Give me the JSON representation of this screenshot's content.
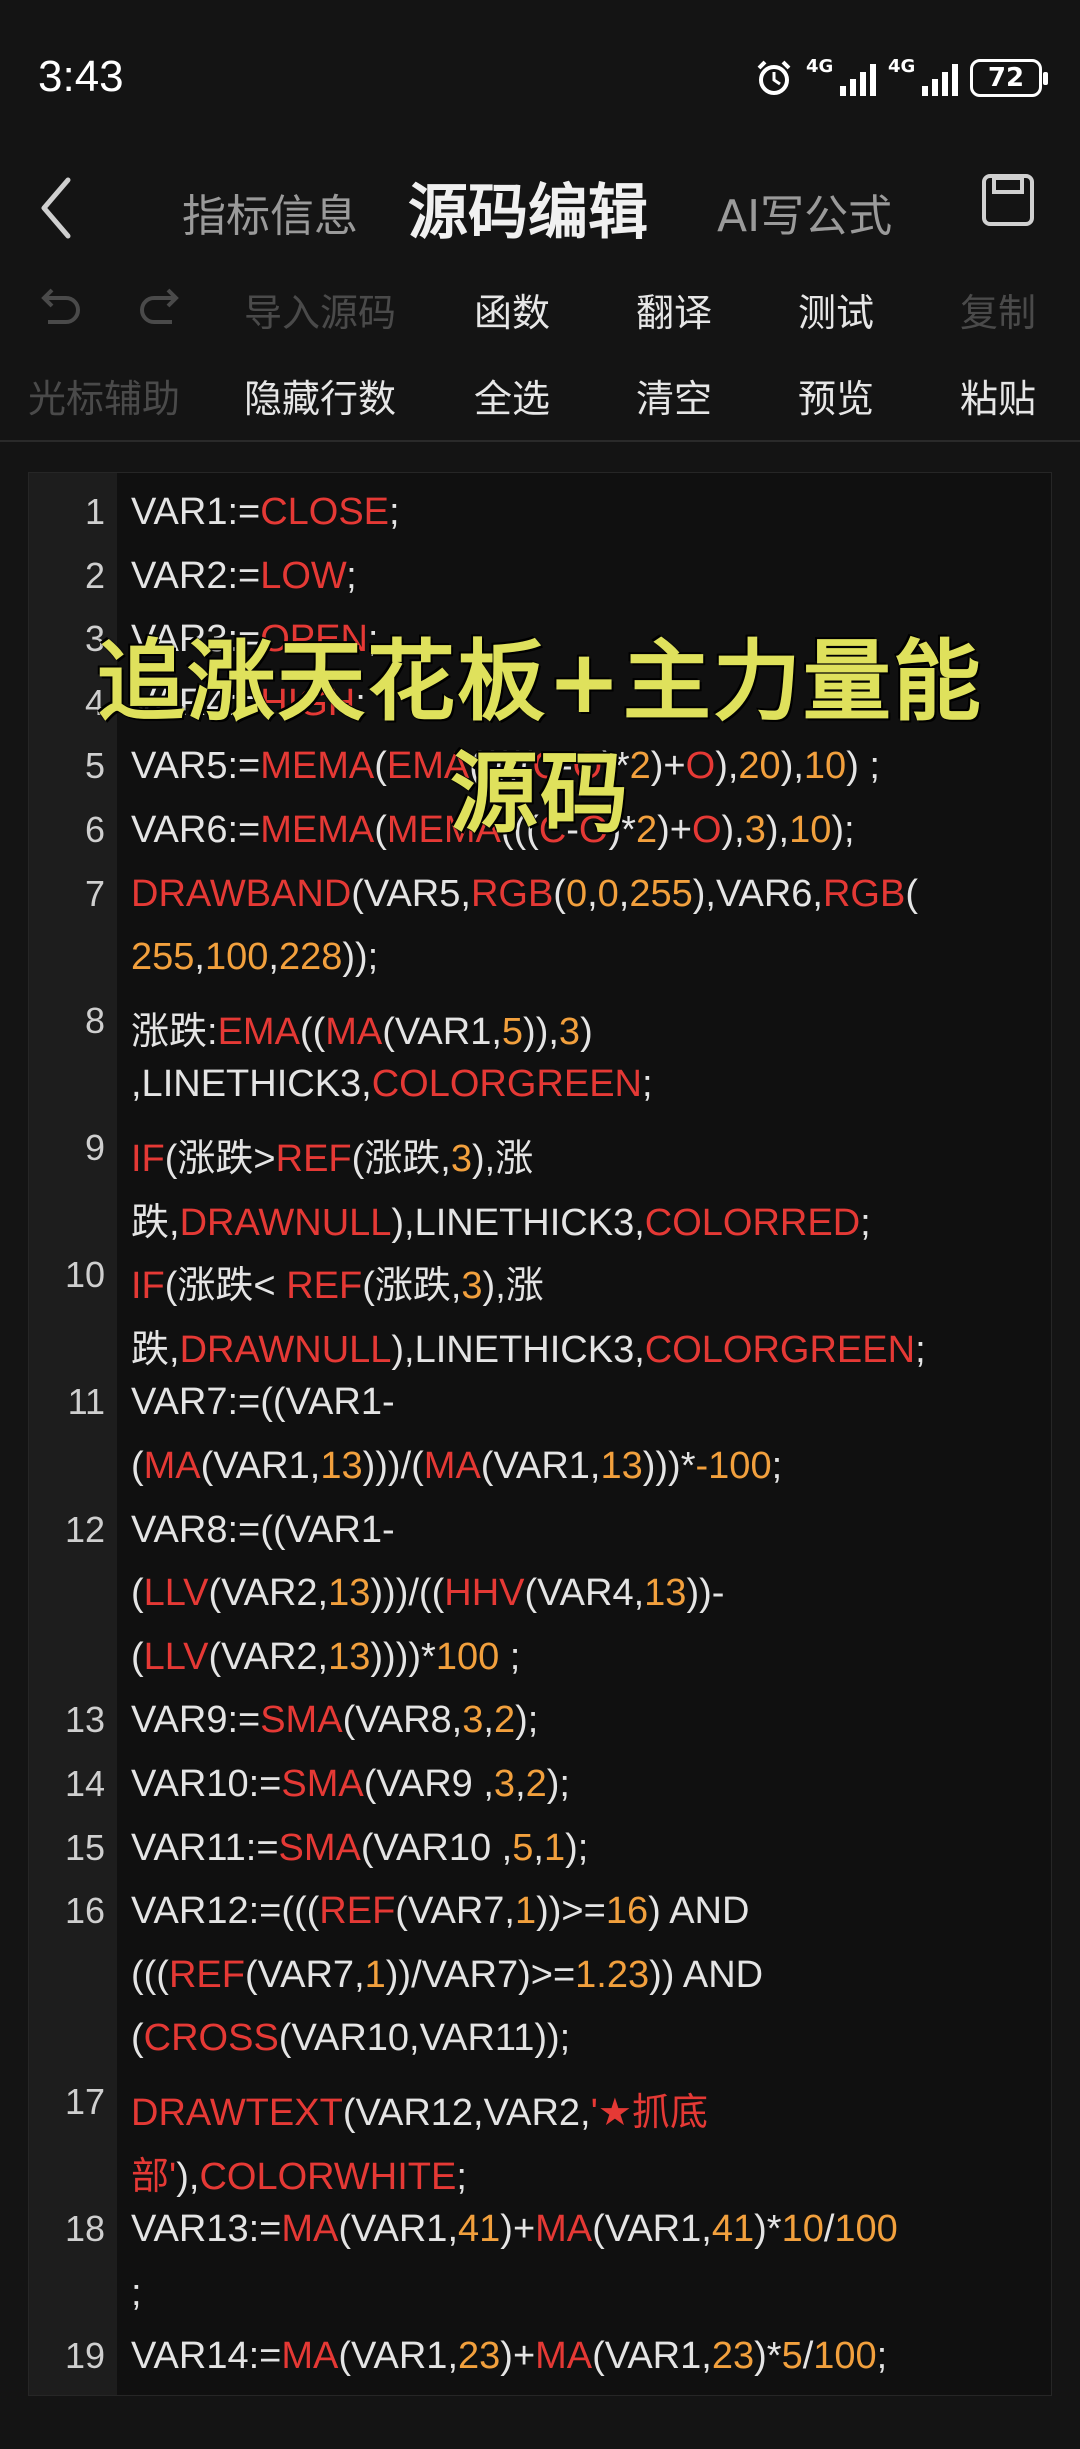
{
  "status": {
    "time": "3:43",
    "net1": "4G",
    "net2": "4G",
    "battery": "72"
  },
  "nav": {
    "tab_info": "指标信息",
    "tab_source": "源码编辑",
    "tab_ai": "AI写公式"
  },
  "toolbar": {
    "import": "导入源码",
    "functions": "函数",
    "translate": "翻译",
    "test": "测试",
    "copy": "复制",
    "cursor_help": "光标辅助",
    "hide_lines": "隐藏行数",
    "select_all": "全选",
    "clear": "清空",
    "preview": "预览",
    "paste": "粘贴"
  },
  "overlay": {
    "line1": "追涨天花板+主力量能",
    "line2": "源码"
  },
  "line_numbers": [
    "1",
    "2",
    "3",
    "4",
    "5",
    "6",
    "7",
    "8",
    "9",
    "10",
    "11",
    "12",
    "13",
    "14",
    "15",
    "16",
    "17",
    "18",
    "19"
  ],
  "code_lines": [
    [
      {
        "t": "VAR1:="
      },
      {
        "t": "CLOSE",
        "c": "k"
      },
      {
        "t": ";"
      }
    ],
    [
      {
        "t": "VAR2:="
      },
      {
        "t": "LOW",
        "c": "k"
      },
      {
        "t": ";"
      }
    ],
    [
      {
        "t": "VAR3:="
      },
      {
        "t": "OPEN",
        "c": "k"
      },
      {
        "t": ";"
      }
    ],
    [
      {
        "t": "VAR4:="
      },
      {
        "t": "HIGH",
        "c": "k"
      },
      {
        "t": ";"
      }
    ],
    [
      {
        "t": "VAR5:="
      },
      {
        "t": "MEMA",
        "c": "k"
      },
      {
        "t": "("
      },
      {
        "t": "EMA",
        "c": "k"
      },
      {
        "t": "((((("
      },
      {
        "t": "C",
        "c": "k"
      },
      {
        "t": "-"
      },
      {
        "t": "O",
        "c": "k"
      },
      {
        "t": ")*"
      },
      {
        "t": "2",
        "c": "n"
      },
      {
        "t": ")+"
      },
      {
        "t": "O",
        "c": "k"
      },
      {
        "t": "),"
      },
      {
        "t": "20",
        "c": "n"
      },
      {
        "t": "),"
      },
      {
        "t": "10",
        "c": "n"
      },
      {
        "t": ") ;"
      }
    ],
    [
      {
        "t": "VAR6:="
      },
      {
        "t": "MEMA",
        "c": "k"
      },
      {
        "t": "("
      },
      {
        "t": "MEMA",
        "c": "k"
      },
      {
        "t": "((("
      },
      {
        "t": "C",
        "c": "k"
      },
      {
        "t": "-"
      },
      {
        "t": "O",
        "c": "k"
      },
      {
        "t": ")*"
      },
      {
        "t": "2",
        "c": "n"
      },
      {
        "t": ")+"
      },
      {
        "t": "O",
        "c": "k"
      },
      {
        "t": "),"
      },
      {
        "t": "3",
        "c": "n"
      },
      {
        "t": "),"
      },
      {
        "t": "10",
        "c": "n"
      },
      {
        "t": ");"
      }
    ],
    [
      {
        "t": "DRAWBAND",
        "c": "k"
      },
      {
        "t": "(VAR5,"
      },
      {
        "t": "RGB",
        "c": "k"
      },
      {
        "t": "("
      },
      {
        "t": "0",
        "c": "n"
      },
      {
        "t": ","
      },
      {
        "t": "0",
        "c": "n"
      },
      {
        "t": ","
      },
      {
        "t": "255",
        "c": "n"
      },
      {
        "t": "),VAR6,"
      },
      {
        "t": "RGB",
        "c": "k"
      },
      {
        "t": "("
      }
    ],
    [
      {
        "t": "255",
        "c": "n"
      },
      {
        "t": ","
      },
      {
        "t": "100",
        "c": "n"
      },
      {
        "t": ","
      },
      {
        "t": "228",
        "c": "n"
      },
      {
        "t": "));"
      }
    ],
    [
      {
        "t": "涨跌:"
      },
      {
        "t": "EMA",
        "c": "k"
      },
      {
        "t": "(("
      },
      {
        "t": "MA",
        "c": "k"
      },
      {
        "t": "(VAR1,"
      },
      {
        "t": "5",
        "c": "n"
      },
      {
        "t": ")),"
      },
      {
        "t": "3",
        "c": "n"
      },
      {
        "t": ")"
      }
    ],
    [
      {
        "t": ",LINETHICK3,"
      },
      {
        "t": "COLORGREEN",
        "c": "k"
      },
      {
        "t": ";"
      }
    ],
    [
      {
        "t": "IF",
        "c": "k"
      },
      {
        "t": "(涨跌>"
      },
      {
        "t": "REF",
        "c": "k"
      },
      {
        "t": "(涨跌,"
      },
      {
        "t": "3",
        "c": "n"
      },
      {
        "t": "),涨"
      }
    ],
    [
      {
        "t": "跌,"
      },
      {
        "t": "DRAWNULL",
        "c": "k"
      },
      {
        "t": "),LINETHICK3,"
      },
      {
        "t": "COLORRED",
        "c": "k"
      },
      {
        "t": ";"
      }
    ],
    [
      {
        "t": "IF",
        "c": "k"
      },
      {
        "t": "(涨跌< "
      },
      {
        "t": "REF",
        "c": "k"
      },
      {
        "t": "(涨跌,"
      },
      {
        "t": "3",
        "c": "n"
      },
      {
        "t": "),涨"
      }
    ],
    [
      {
        "t": "跌,"
      },
      {
        "t": "DRAWNULL",
        "c": "k"
      },
      {
        "t": "),LINETHICK3,"
      },
      {
        "t": "COLORGREEN",
        "c": "k"
      },
      {
        "t": ";"
      }
    ],
    [
      {
        "t": "VAR7:=((VAR1-"
      }
    ],
    [
      {
        "t": "("
      },
      {
        "t": "MA",
        "c": "k"
      },
      {
        "t": "(VAR1,"
      },
      {
        "t": "13",
        "c": "n"
      },
      {
        "t": ")))/("
      },
      {
        "t": "MA",
        "c": "k"
      },
      {
        "t": "(VAR1,"
      },
      {
        "t": "13",
        "c": "n"
      },
      {
        "t": ")))*"
      },
      {
        "t": "-100",
        "c": "n"
      },
      {
        "t": ";"
      }
    ],
    [
      {
        "t": "VAR8:=((VAR1-"
      }
    ],
    [
      {
        "t": "("
      },
      {
        "t": "LLV",
        "c": "k"
      },
      {
        "t": "(VAR2,"
      },
      {
        "t": "13",
        "c": "n"
      },
      {
        "t": ")))/(("
      },
      {
        "t": "HHV",
        "c": "k"
      },
      {
        "t": "(VAR4,"
      },
      {
        "t": "13",
        "c": "n"
      },
      {
        "t": "))-"
      }
    ],
    [
      {
        "t": "("
      },
      {
        "t": "LLV",
        "c": "k"
      },
      {
        "t": "(VAR2,"
      },
      {
        "t": "13",
        "c": "n"
      },
      {
        "t": "))))*"
      },
      {
        "t": "100",
        "c": "n"
      },
      {
        "t": " ;"
      }
    ],
    [
      {
        "t": "VAR9:="
      },
      {
        "t": "SMA",
        "c": "k"
      },
      {
        "t": "(VAR8,"
      },
      {
        "t": "3",
        "c": "n"
      },
      {
        "t": ","
      },
      {
        "t": "2",
        "c": "n"
      },
      {
        "t": ");"
      }
    ],
    [
      {
        "t": "VAR10:="
      },
      {
        "t": "SMA",
        "c": "k"
      },
      {
        "t": "(VAR9 ,"
      },
      {
        "t": "3",
        "c": "n"
      },
      {
        "t": ","
      },
      {
        "t": "2",
        "c": "n"
      },
      {
        "t": ");"
      }
    ],
    [
      {
        "t": "VAR11:="
      },
      {
        "t": "SMA",
        "c": "k"
      },
      {
        "t": "(VAR10 ,"
      },
      {
        "t": "5",
        "c": "n"
      },
      {
        "t": ","
      },
      {
        "t": "1",
        "c": "n"
      },
      {
        "t": ");"
      }
    ],
    [
      {
        "t": "VAR12:=((("
      },
      {
        "t": "REF",
        "c": "k"
      },
      {
        "t": "(VAR7,"
      },
      {
        "t": "1",
        "c": "n"
      },
      {
        "t": "))>="
      },
      {
        "t": "16",
        "c": "n"
      },
      {
        "t": ") AND"
      }
    ],
    [
      {
        "t": "((("
      },
      {
        "t": "REF",
        "c": "k"
      },
      {
        "t": "(VAR7,"
      },
      {
        "t": "1",
        "c": "n"
      },
      {
        "t": "))/VAR7)>="
      },
      {
        "t": "1.23",
        "c": "n"
      },
      {
        "t": ")) AND"
      }
    ],
    [
      {
        "t": "("
      },
      {
        "t": "CROSS",
        "c": "k"
      },
      {
        "t": "(VAR10,VAR11));"
      }
    ],
    [
      {
        "t": "DRAWTEXT",
        "c": "k"
      },
      {
        "t": "(VAR12,VAR2,"
      },
      {
        "t": "'★抓底",
        "c": "k"
      }
    ],
    [
      {
        "t": "部'",
        "c": "k"
      },
      {
        "t": "),"
      },
      {
        "t": "COLORWHITE",
        "c": "k"
      },
      {
        "t": ";"
      }
    ],
    [
      {
        "t": "VAR13:="
      },
      {
        "t": "MA",
        "c": "k"
      },
      {
        "t": "(VAR1,"
      },
      {
        "t": "41",
        "c": "n"
      },
      {
        "t": ")+"
      },
      {
        "t": "MA",
        "c": "k"
      },
      {
        "t": "(VAR1,"
      },
      {
        "t": "41",
        "c": "n"
      },
      {
        "t": ")*"
      },
      {
        "t": "10",
        "c": "n"
      },
      {
        "t": "/"
      },
      {
        "t": "100",
        "c": "n"
      }
    ],
    [
      {
        "t": ";"
      }
    ],
    [
      {
        "t": "VAR14:="
      },
      {
        "t": "MA",
        "c": "k"
      },
      {
        "t": "(VAR1,"
      },
      {
        "t": "23",
        "c": "n"
      },
      {
        "t": ")+"
      },
      {
        "t": "MA",
        "c": "k"
      },
      {
        "t": "(VAR1,"
      },
      {
        "t": "23",
        "c": "n"
      },
      {
        "t": ")*"
      },
      {
        "t": "5",
        "c": "n"
      },
      {
        "t": "/"
      },
      {
        "t": "100",
        "c": "n"
      },
      {
        "t": ";"
      }
    ]
  ],
  "colors": {
    "keyword": "#e53935",
    "number": "#f2a03d",
    "overlay": "#dfe15c",
    "background": "#141414"
  }
}
